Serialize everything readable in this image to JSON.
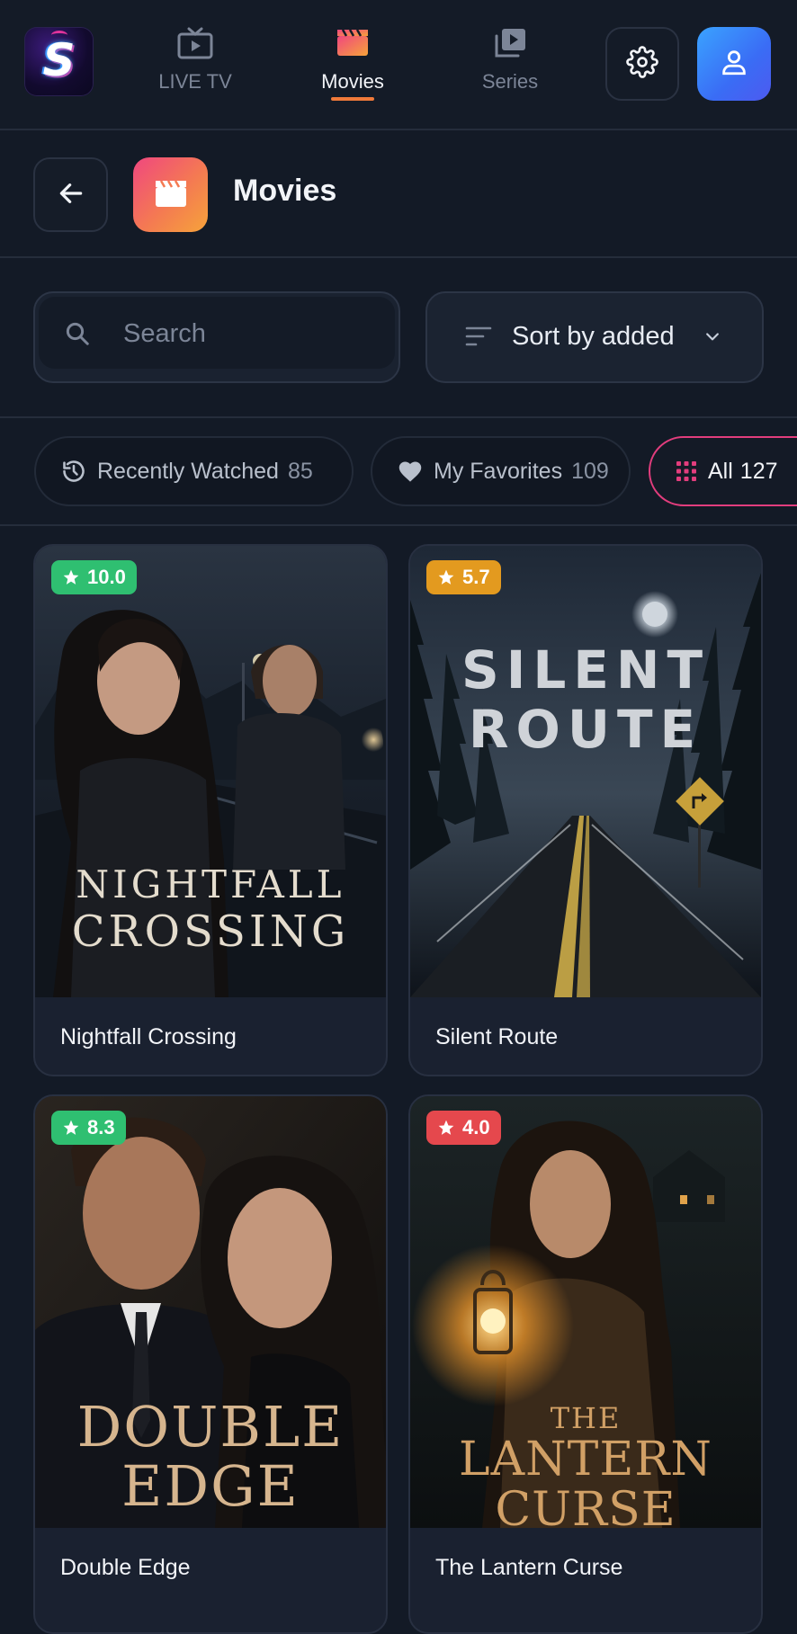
{
  "nav": {
    "items": [
      {
        "label": "LIVE TV",
        "icon": "tv-icon"
      },
      {
        "label": "Movies",
        "icon": "clapperboard-icon"
      },
      {
        "label": "Series",
        "icon": "play-stack-icon"
      }
    ],
    "active": "Movies",
    "settings_icon": "gear-icon",
    "profile_icon": "user-icon"
  },
  "header": {
    "title": "Movies",
    "back_icon": "arrow-left-icon",
    "icon": "clapperboard-icon"
  },
  "search": {
    "placeholder": "Search",
    "value": ""
  },
  "sort": {
    "label": "Sort by added"
  },
  "chips": [
    {
      "label": "Recently Watched",
      "count": "85",
      "icon": "history-icon"
    },
    {
      "label": "My Favorites",
      "count": "109",
      "icon": "heart-icon"
    },
    {
      "label": "All",
      "count": "127",
      "icon": "grid-icon",
      "selected": true
    }
  ],
  "movies": [
    {
      "title": "Nightfall Crossing",
      "rating": "10.0",
      "rating_color": "#2fbf71",
      "poster_text": [
        "NIGHTFALL",
        "CROSSING"
      ]
    },
    {
      "title": "Silent Route",
      "rating": "5.7",
      "rating_color": "#e39a1f",
      "poster_text": [
        "SILENT",
        "ROUTE"
      ]
    },
    {
      "title": "Double Edge",
      "rating": "8.3",
      "rating_color": "#2fbf71",
      "poster_text": [
        "DOUBLE",
        "EDGE"
      ]
    },
    {
      "title": "The Lantern Curse",
      "rating": "4.0",
      "rating_color": "#e5484d",
      "poster_text": [
        "THE",
        "LANTERN",
        "CURSE"
      ]
    }
  ],
  "colors": {
    "background": "#131a26",
    "accent": "#f07a3a",
    "chip_selected_border": "#e23d7d",
    "profile_gradient": "#3a8cf5"
  }
}
